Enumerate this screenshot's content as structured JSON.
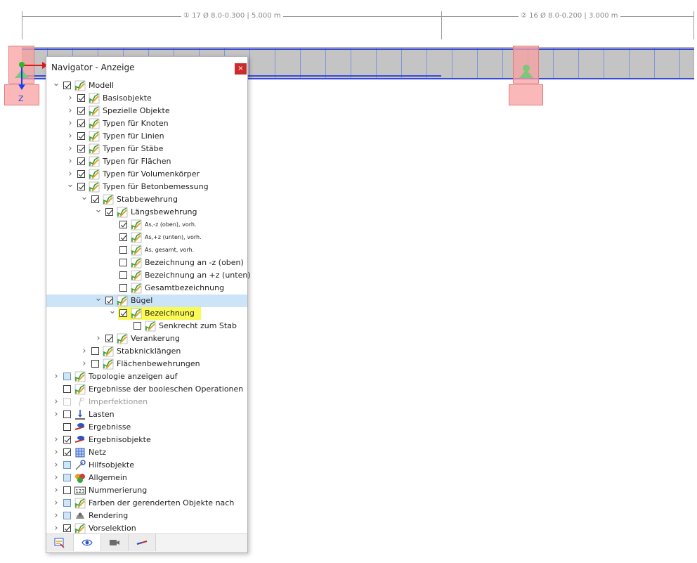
{
  "model": {
    "span1_label": "① 17 Ø 8.0-0.300 | 5.000 m",
    "span2_label": "② 16 Ø 8.0-0.200 | 3.000 m",
    "axis_z_label": "Z"
  },
  "navigator": {
    "title": "Navigator - Anzeige",
    "close_label": "×",
    "items": [
      {
        "label": "Modell",
        "level": 0,
        "expander": "open",
        "check": "checked",
        "icon": "model-icon"
      },
      {
        "label": "Basisobjekte",
        "level": 1,
        "expander": "closed",
        "check": "checked",
        "icon": "model-icon"
      },
      {
        "label": "Spezielle Objekte",
        "level": 1,
        "expander": "closed",
        "check": "checked",
        "icon": "model-icon"
      },
      {
        "label": "Typen für Knoten",
        "level": 1,
        "expander": "closed",
        "check": "checked",
        "icon": "model-icon"
      },
      {
        "label": "Typen für Linien",
        "level": 1,
        "expander": "closed",
        "check": "checked",
        "icon": "model-icon"
      },
      {
        "label": "Typen für Stäbe",
        "level": 1,
        "expander": "closed",
        "check": "checked",
        "icon": "model-icon"
      },
      {
        "label": "Typen für Flächen",
        "level": 1,
        "expander": "closed",
        "check": "checked",
        "icon": "model-icon"
      },
      {
        "label": "Typen für Volumenkörper",
        "level": 1,
        "expander": "closed",
        "check": "checked",
        "icon": "model-icon"
      },
      {
        "label": "Typen für Betonbemessung",
        "level": 1,
        "expander": "open",
        "check": "checked",
        "icon": "model-icon"
      },
      {
        "label": "Stabbewehrung",
        "level": 2,
        "expander": "open",
        "check": "checked",
        "icon": "model-icon"
      },
      {
        "label": "Längsbewehrung",
        "level": 3,
        "expander": "open",
        "check": "checked",
        "icon": "model-icon"
      },
      {
        "label": "As,-z (oben), vorh.",
        "level": 4,
        "expander": "none",
        "check": "checked",
        "icon": "model-icon",
        "small": true
      },
      {
        "label": "As,+z (unten), vorh.",
        "level": 4,
        "expander": "none",
        "check": "checked",
        "icon": "model-icon",
        "small": true
      },
      {
        "label": "As, gesamt, vorh.",
        "level": 4,
        "expander": "none",
        "check": "unchecked",
        "icon": "model-icon",
        "small": true
      },
      {
        "label": "Bezeichnung an -z (oben)",
        "level": 4,
        "expander": "none",
        "check": "unchecked",
        "icon": "model-icon"
      },
      {
        "label": "Bezeichnung an +z (unten)",
        "level": 4,
        "expander": "none",
        "check": "unchecked",
        "icon": "model-icon"
      },
      {
        "label": "Gesamtbezeichnung",
        "level": 4,
        "expander": "none",
        "check": "unchecked",
        "icon": "model-icon"
      },
      {
        "label": "Bügel",
        "level": 3,
        "expander": "open",
        "check": "checked",
        "icon": "model-icon",
        "selected": true
      },
      {
        "label": "Bezeichnung",
        "level": 4,
        "expander": "open",
        "check": "checked",
        "icon": "model-icon",
        "highlight": true
      },
      {
        "label": "Senkrecht zum Stab",
        "level": 5,
        "expander": "none",
        "check": "unchecked",
        "icon": "model-icon"
      },
      {
        "label": "Verankerung",
        "level": 3,
        "expander": "closed",
        "check": "checked",
        "icon": "model-icon"
      },
      {
        "label": "Stabknicklängen",
        "level": 2,
        "expander": "closed",
        "check": "unchecked",
        "icon": "model-icon"
      },
      {
        "label": "Flächenbewehrungen",
        "level": 2,
        "expander": "closed",
        "check": "unchecked",
        "icon": "model-icon"
      },
      {
        "label": "Topologie anzeigen auf",
        "level": 0,
        "expander": "closed",
        "check": "partial",
        "icon": "model-icon"
      },
      {
        "label": "Ergebnisse der booleschen Operationen",
        "level": 0,
        "expander": "none",
        "check": "unchecked",
        "icon": "model-icon"
      },
      {
        "label": "Imperfektionen",
        "level": 0,
        "expander": "closed",
        "check": "disabled",
        "icon": "imperfection-icon",
        "disabled": true
      },
      {
        "label": "Lasten",
        "level": 0,
        "expander": "closed",
        "check": "unchecked",
        "icon": "load-icon"
      },
      {
        "label": "Ergebnisse",
        "level": 0,
        "expander": "none",
        "check": "unchecked",
        "icon": "results-icon"
      },
      {
        "label": "Ergebnisobjekte",
        "level": 0,
        "expander": "closed",
        "check": "checked",
        "icon": "result-objects-icon"
      },
      {
        "label": "Netz",
        "level": 0,
        "expander": "closed",
        "check": "checked",
        "icon": "mesh-icon"
      },
      {
        "label": "Hilfsobjekte",
        "level": 0,
        "expander": "closed",
        "check": "partial",
        "icon": "guide-objects-icon"
      },
      {
        "label": "Allgemein",
        "level": 0,
        "expander": "closed",
        "check": "partial",
        "icon": "general-icon"
      },
      {
        "label": "Nummerierung",
        "level": 0,
        "expander": "closed",
        "check": "unchecked",
        "icon": "numbering-icon"
      },
      {
        "label": "Farben der gerenderten Objekte nach",
        "level": 0,
        "expander": "closed",
        "check": "partial",
        "icon": "model-icon"
      },
      {
        "label": "Rendering",
        "level": 0,
        "expander": "closed",
        "check": "partial",
        "icon": "rendering-icon"
      },
      {
        "label": "Vorselektion",
        "level": 0,
        "expander": "closed",
        "check": "checked",
        "icon": "preselection-icon"
      }
    ],
    "tabs": [
      {
        "name": "data-tab",
        "icon": "data-icon"
      },
      {
        "name": "display-tab",
        "icon": "eye-icon",
        "active": true
      },
      {
        "name": "views-tab",
        "icon": "camera-icon"
      },
      {
        "name": "results-tab",
        "icon": "results-tab-icon"
      }
    ]
  }
}
